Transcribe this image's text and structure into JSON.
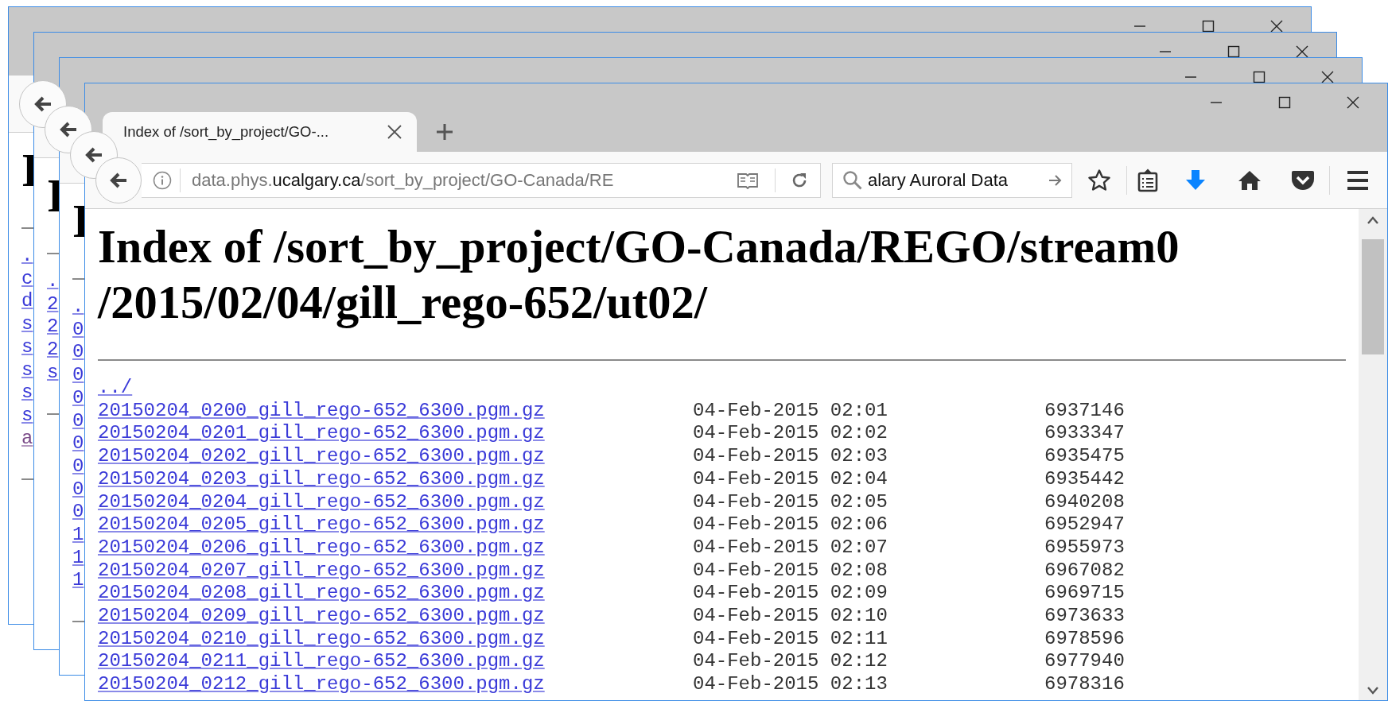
{
  "background_windows": [
    {
      "heading": "I",
      "links": [
        {
          "text": ".",
          "visited": false
        },
        {
          "text": "c",
          "visited": false
        },
        {
          "text": "d",
          "visited": false
        },
        {
          "text": "s",
          "visited": false
        },
        {
          "text": "s",
          "visited": false
        },
        {
          "text": "s",
          "visited": false
        },
        {
          "text": "s",
          "visited": false
        },
        {
          "text": "s",
          "visited": false
        },
        {
          "text": "a",
          "visited": true
        }
      ]
    },
    {
      "heading": "I",
      "links": [
        {
          "text": ".",
          "visited": false
        },
        {
          "text": "2",
          "visited": false
        },
        {
          "text": "2",
          "visited": false
        },
        {
          "text": "2",
          "visited": false
        },
        {
          "text": "s",
          "visited": false
        }
      ]
    },
    {
      "heading": "I",
      "links": [
        {
          "text": ".",
          "visited": false
        },
        {
          "text": "0",
          "visited": false
        },
        {
          "text": "0",
          "visited": false
        },
        {
          "text": "0",
          "visited": false
        },
        {
          "text": "0",
          "visited": false
        },
        {
          "text": "0",
          "visited": false
        },
        {
          "text": "0",
          "visited": false
        },
        {
          "text": "0",
          "visited": false
        },
        {
          "text": "0",
          "visited": false
        },
        {
          "text": "0",
          "visited": false
        },
        {
          "text": "1",
          "visited": false
        },
        {
          "text": "1",
          "visited": false
        },
        {
          "text": "1",
          "visited": false
        }
      ]
    }
  ],
  "window": {
    "tabs": [
      {
        "title": "Index of /sort_by_project/GO-...",
        "selected": true
      }
    ],
    "address": {
      "prefix": "data.phys.",
      "domain": "ucalgary.ca",
      "path": "/sort_by_project/GO-Canada/RE"
    },
    "search": {
      "value": "alary Auroral Data"
    },
    "page": {
      "heading": "Index of /sort_by_project/GO-Canada/REGO/stream0/2015/02/04/gill_rego-652/ut02/",
      "parent_link": "../",
      "rows": [
        {
          "name": "20150204_0200_gill_rego-652_6300.pgm.gz",
          "date": "04-Feb-2015 02:01",
          "size": "6937146",
          "visited": false
        },
        {
          "name": "20150204_0201_gill_rego-652_6300.pgm.gz",
          "date": "04-Feb-2015 02:02",
          "size": "6933347",
          "visited": false
        },
        {
          "name": "20150204_0202_gill_rego-652_6300.pgm.gz",
          "date": "04-Feb-2015 02:03",
          "size": "6935475",
          "visited": false
        },
        {
          "name": "20150204_0203_gill_rego-652_6300.pgm.gz",
          "date": "04-Feb-2015 02:04",
          "size": "6935442",
          "visited": false
        },
        {
          "name": "20150204_0204_gill_rego-652_6300.pgm.gz",
          "date": "04-Feb-2015 02:05",
          "size": "6940208",
          "visited": false
        },
        {
          "name": "20150204_0205_gill_rego-652_6300.pgm.gz",
          "date": "04-Feb-2015 02:06",
          "size": "6952947",
          "visited": false
        },
        {
          "name": "20150204_0206_gill_rego-652_6300.pgm.gz",
          "date": "04-Feb-2015 02:07",
          "size": "6955973",
          "visited": false
        },
        {
          "name": "20150204_0207_gill_rego-652_6300.pgm.gz",
          "date": "04-Feb-2015 02:08",
          "size": "6967082",
          "visited": false
        },
        {
          "name": "20150204_0208_gill_rego-652_6300.pgm.gz",
          "date": "04-Feb-2015 02:09",
          "size": "6969715",
          "visited": false
        },
        {
          "name": "20150204_0209_gill_rego-652_6300.pgm.gz",
          "date": "04-Feb-2015 02:10",
          "size": "6973633",
          "visited": false
        },
        {
          "name": "20150204_0210_gill_rego-652_6300.pgm.gz",
          "date": "04-Feb-2015 02:11",
          "size": "6978596",
          "visited": false
        },
        {
          "name": "20150204_0211_gill_rego-652_6300.pgm.gz",
          "date": "04-Feb-2015 02:12",
          "size": "6977940",
          "visited": false
        },
        {
          "name": "20150204_0212_gill_rego-652_6300.pgm.gz",
          "date": "04-Feb-2015 02:13",
          "size": "6978316",
          "visited": false
        }
      ]
    }
  }
}
